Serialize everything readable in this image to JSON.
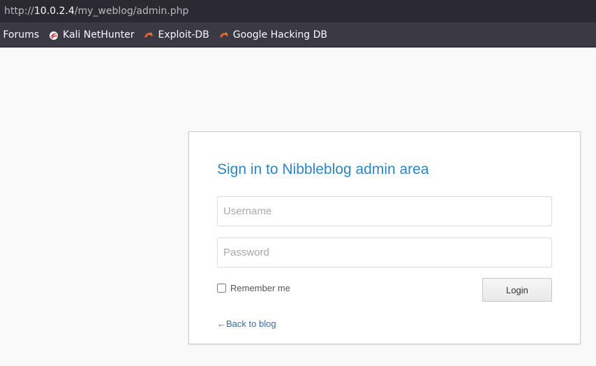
{
  "browser": {
    "url_scheme": "http://",
    "url_host": "10.0.2.4",
    "url_path": "/my_weblog/admin.php",
    "bookmarks": [
      {
        "label": "i Forums",
        "icon": ""
      },
      {
        "label": "Kali NetHunter",
        "icon": "nethunter-icon"
      },
      {
        "label": "Exploit-DB",
        "icon": "exploit-db-icon"
      },
      {
        "label": "Google Hacking DB",
        "icon": "exploit-db-icon"
      }
    ]
  },
  "login": {
    "title": "Sign in to Nibbleblog admin area",
    "username_placeholder": "Username",
    "password_placeholder": "Password",
    "remember_label": "Remember me",
    "login_button": "Login",
    "back_link": "←Back to blog"
  },
  "colors": {
    "title": "#2a86c8",
    "link": "#2a6eb7",
    "toolbar_bg": "#2b2a33",
    "bookmarks_bg": "#3a3944",
    "exploit_db_icon": "#e0632d",
    "nethunter_icon": "#d33a3a"
  }
}
